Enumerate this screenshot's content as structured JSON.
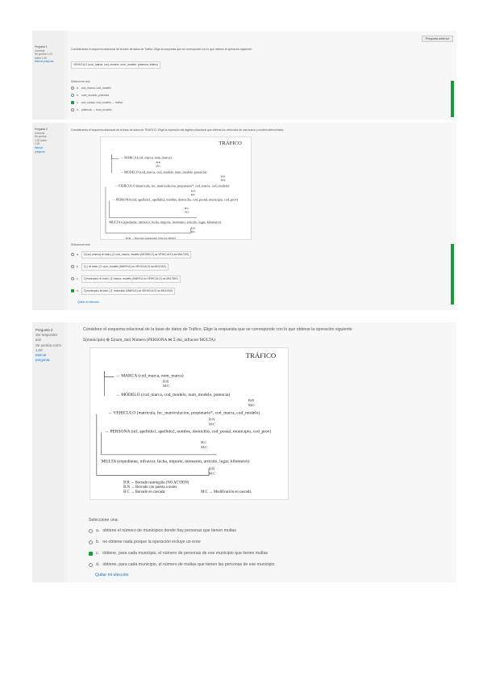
{
  "q1": {
    "nav_button": "Pregunta anterior",
    "info": [
      "Pregunta 1",
      "Correcta",
      "Se puntúa 1,00",
      "sobre 1,00",
      "Marcar pregunta"
    ],
    "prompt": "Considerando el esquema relacional de la base de datos de Tráfico. Elige la respuesta que se corresponde con lo que obtiene la operación siguiente:",
    "formula": "VEHICULO (cod_marca, cod_modelo, num_modelo, potencia, tráfico)",
    "select_label": "Seleccione una:",
    "options": [
      {
        "letter": "a.",
        "text": "cod_marca, cod_modelo",
        "selected": false
      },
      {
        "letter": "b.",
        "text": "num_modelo, potencia",
        "selected": false
      },
      {
        "letter": "c.",
        "text": "cod_marca, cod_modelo → tráfico",
        "selected": true
      },
      {
        "letter": "d.",
        "text": "potencia → num_modelo",
        "selected": false
      }
    ]
  },
  "q2": {
    "info": [
      "Pregunta 2",
      "Correcta",
      "Se puntúa",
      "1,00 sobre",
      "1,00",
      "Marcar",
      "pregunta"
    ],
    "prompt": "Considerando el esquema relacional de la base de datos de TRAFICO. Elige la expresión del álgebra relacional que obtiene los vehículos de una marca y modelo determinado:",
    "select_label": "Seleccione una:",
    "options": [
      {
        "letter": "a.",
        "text": "Σ(cod_marca) ⊕ total ( (Σ cod_marca, modelo (MODELO) ⋈ VEHICULO) ⋈ MULTAS)",
        "selected": false
      },
      {
        "letter": "b.",
        "text": "Σ( ) ⊕ total ( (Σ num_modelo (MARCA) ⋈ VEHICULO) ⋈ MULTAS)",
        "selected": false
      },
      {
        "letter": "c.",
        "text": "Σ(municipio) ⊕ total ( (Σ marca, modelo (MARCA ⋈ VEHICULO) ⋈ MULTAS)",
        "selected": false
      },
      {
        "letter": "d.",
        "text": "Σ(municipio) ⊕ total ( (Σ municipio (MARCA) ⋈ VEHICULO) ⋈ MULTAS)",
        "selected": true
      }
    ],
    "clear": "Quitar mi elección"
  },
  "q3": {
    "info": {
      "qnum": "Pregunta 3",
      "state": "Sin responder aún",
      "score": "Se puntúa como 1,00",
      "flag": "Marcar pregunta"
    },
    "prompt": "Considere el esquema relacional de la base de datos de Tráfico. Elige la respuesta que se corresponde con lo que obtiene la operación siguiente",
    "formula": "Σ(municipio) ⊕ Σ(num_dni) Número (PERSONA ⋈ Σ dni_infractor MULTA)",
    "select_label": "Seleccione una:",
    "options": [
      {
        "letter": "a.",
        "text": "obtiene el número de municipios donde hay personas que tienen multas",
        "selected": false
      },
      {
        "letter": "b.",
        "text": "no obtiene nada porque la operación incluye un error",
        "selected": false
      },
      {
        "letter": "c.",
        "text": "obtiene, para cada municipio, el número de personas de ese municipio que tienen multas",
        "selected": true
      },
      {
        "letter": "d.",
        "text": "obtiene, para cada municipio, el número de multas que tienen las personas de ese municipio",
        "selected": false
      }
    ],
    "clear": "Quitar mi elección"
  },
  "diagram": {
    "title": "TRÁFICO",
    "marca": "MARCA (cod_marca, nom_marca)",
    "modelo": "MODELO (cod_marca, cod_modelo, num_modelo, potencia)",
    "vehiculo": "VEHICULO (matricula, fec_matriculacion, propietario*, cod_marca, cod_modelo)",
    "persona": "PERSONA (nif, apellido1, apellido2, nombre, domicilio, cod_postal, municipio, cod_prov)",
    "multa": "MULTA (expediente, infractor, fecha, importe, momento, articulo, lugar, kilometro)",
    "br": "B:R",
    "mc": "M:C",
    "bn": "B:N",
    "bc": "B:C",
    "legend1": "B:R → Borrado restringido (NO ACTION)",
    "legend2": "B:N → Borrado con puesta a nulos",
    "legend3": "B:C → Borrado en cascada",
    "legend4": "M:C → Modificación en cascada"
  },
  "colors": {
    "correct": "#1b9a3c",
    "link": "#1177d1"
  }
}
